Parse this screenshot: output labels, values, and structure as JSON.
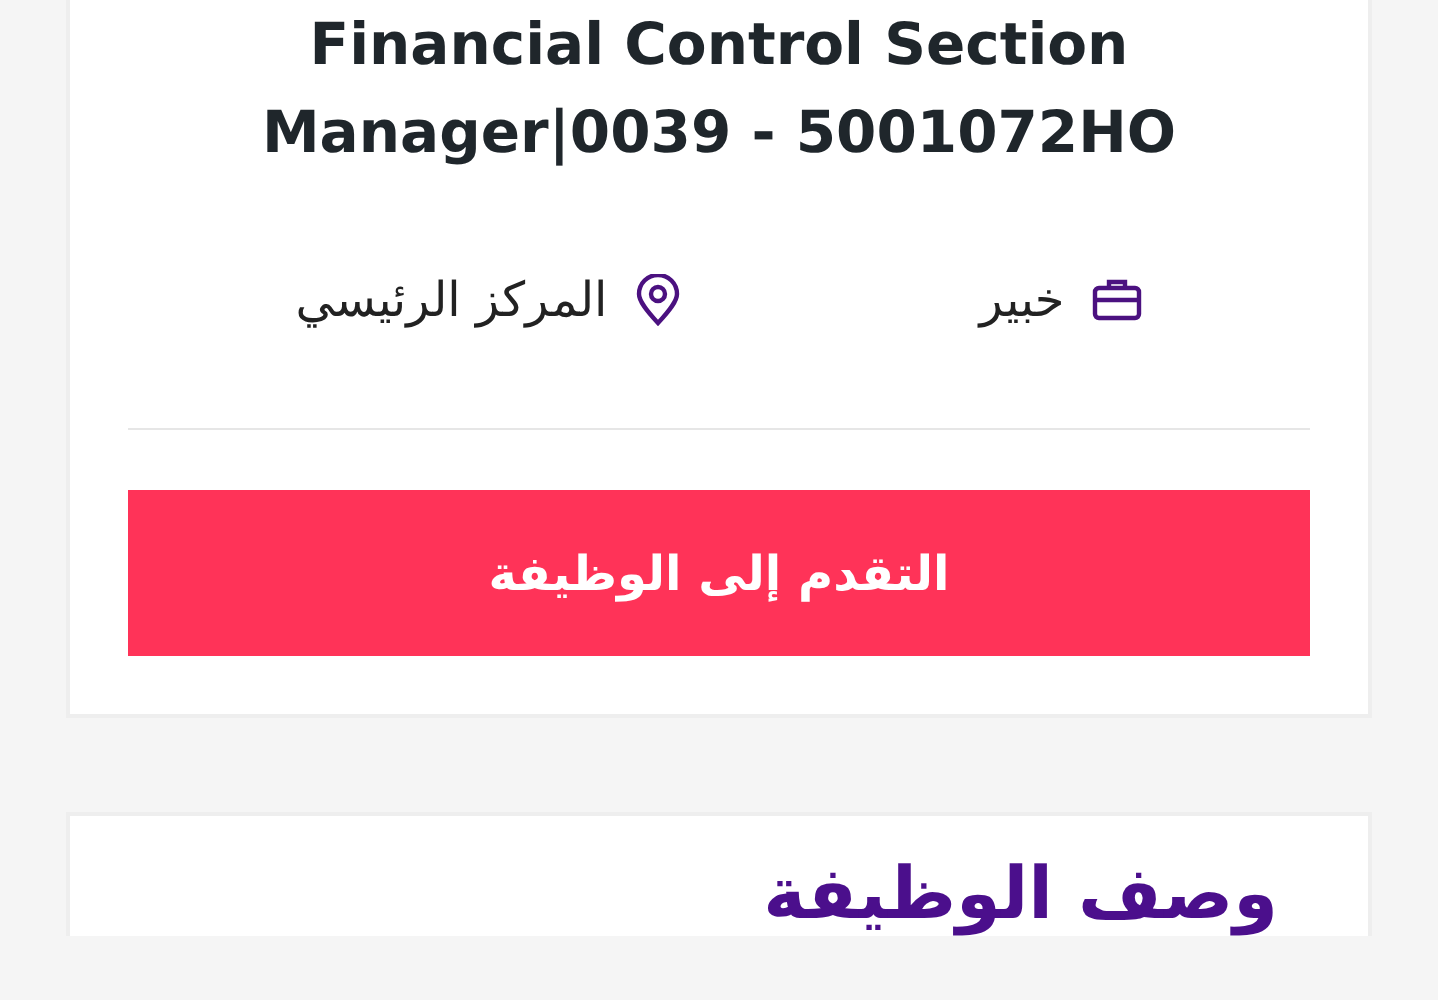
{
  "job": {
    "title": "Financial Control Section Manager|0039 - 5001072HO",
    "level": "خبير",
    "location": "المركز الرئيسي",
    "apply_button": "التقدم إلى الوظيفة"
  },
  "description": {
    "heading": "وصف الوظيفة"
  }
}
